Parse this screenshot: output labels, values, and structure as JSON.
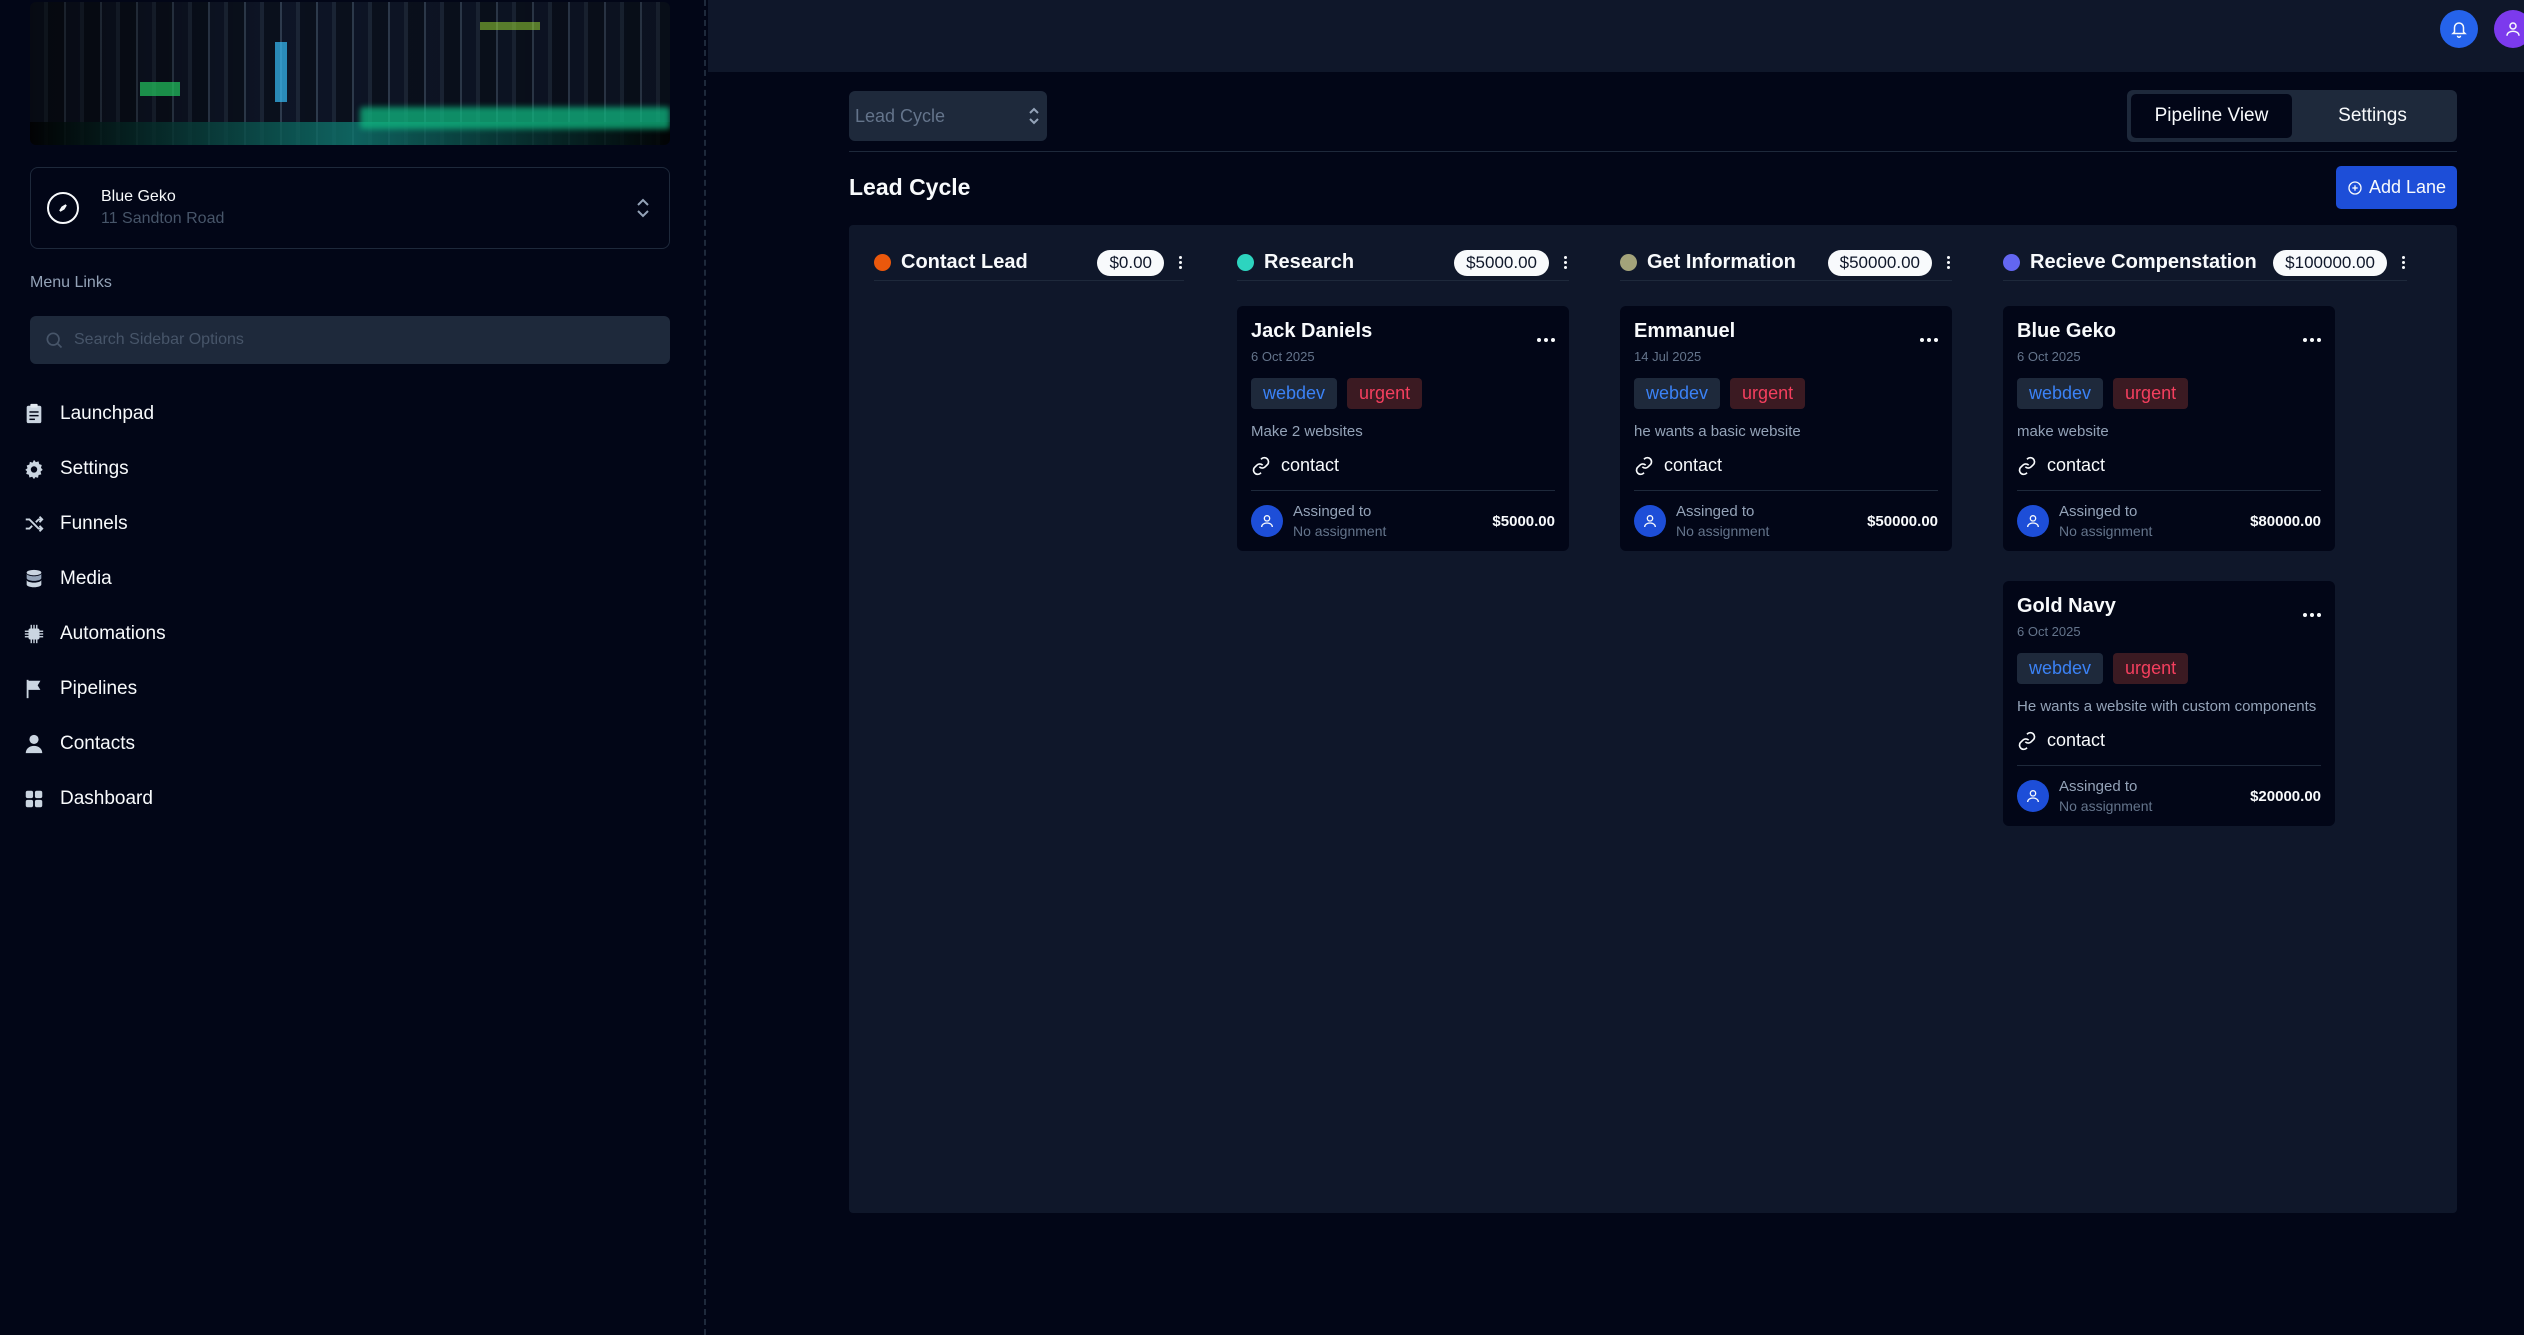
{
  "account": {
    "name": "Blue Geko",
    "address": "11 Sandton Road"
  },
  "sidebar": {
    "menu_label": "Menu Links",
    "search_placeholder": "Search Sidebar Options",
    "items": [
      {
        "label": "Launchpad",
        "icon": "clipboard-icon"
      },
      {
        "label": "Settings",
        "icon": "gear-icon"
      },
      {
        "label": "Funnels",
        "icon": "shuffle-icon"
      },
      {
        "label": "Media",
        "icon": "database-icon"
      },
      {
        "label": "Automations",
        "icon": "chip-icon"
      },
      {
        "label": "Pipelines",
        "icon": "flag-icon"
      },
      {
        "label": "Contacts",
        "icon": "person-icon"
      },
      {
        "label": "Dashboard",
        "icon": "grid-icon"
      }
    ]
  },
  "toolbar": {
    "pipeline_select": "Lead Cycle",
    "tabs": [
      "Pipeline View",
      "Settings"
    ],
    "active_tab": "Pipeline View"
  },
  "board": {
    "title": "Lead Cycle",
    "add_lane_label": "Add Lane",
    "lanes": [
      {
        "name": "Contact Lead",
        "total": "$0.00",
        "color": "#ea580c",
        "cards": []
      },
      {
        "name": "Research",
        "total": "$5000.00",
        "color": "#2dd4bf",
        "cards": [
          {
            "title": "Jack Daniels",
            "date": "6 Oct 2025",
            "tags": [
              "webdev",
              "urgent"
            ],
            "description": "Make 2 websites",
            "link": "contact",
            "assigned_label": "Assinged to",
            "assignee": "No assignment",
            "amount": "$5000.00"
          }
        ]
      },
      {
        "name": "Get Information",
        "total": "$50000.00",
        "color": "#a3a37a",
        "cards": [
          {
            "title": "Emmanuel",
            "date": "14 Jul 2025",
            "tags": [
              "webdev",
              "urgent"
            ],
            "description": "he wants a basic website",
            "link": "contact",
            "assigned_label": "Assinged to",
            "assignee": "No assignment",
            "amount": "$50000.00"
          }
        ]
      },
      {
        "name": "Recieve Compenstation",
        "total": "$100000.00",
        "color": "#6366f1",
        "cards": [
          {
            "title": "Blue Geko",
            "date": "6 Oct 2025",
            "tags": [
              "webdev",
              "urgent"
            ],
            "description": "make website",
            "link": "contact",
            "assigned_label": "Assinged to",
            "assignee": "No assignment",
            "amount": "$80000.00"
          },
          {
            "title": "Gold Navy",
            "date": "6 Oct 2025",
            "tags": [
              "webdev",
              "urgent"
            ],
            "description": "He wants a website with custom components",
            "link": "contact",
            "assigned_label": "Assinged to",
            "assignee": "No assignment",
            "amount": "$20000.00"
          }
        ]
      }
    ]
  }
}
